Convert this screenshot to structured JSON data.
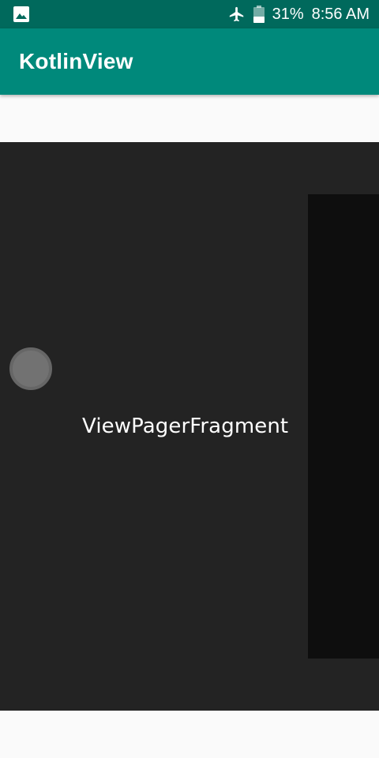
{
  "status_bar": {
    "left_icon": "image-icon",
    "airplane_icon": "airplane-icon",
    "battery_icon": "battery-icon",
    "battery": "31%",
    "time": "8:56 AM"
  },
  "app_bar": {
    "title": "KotlinView"
  },
  "pager": {
    "fragment_label": "ViewPagerFragment"
  },
  "colors": {
    "status_bar": "#00695c",
    "app_bar": "#00897b",
    "pager_background": "#232323",
    "next_page": "#0e0e0e",
    "page_background": "#fafafa"
  }
}
